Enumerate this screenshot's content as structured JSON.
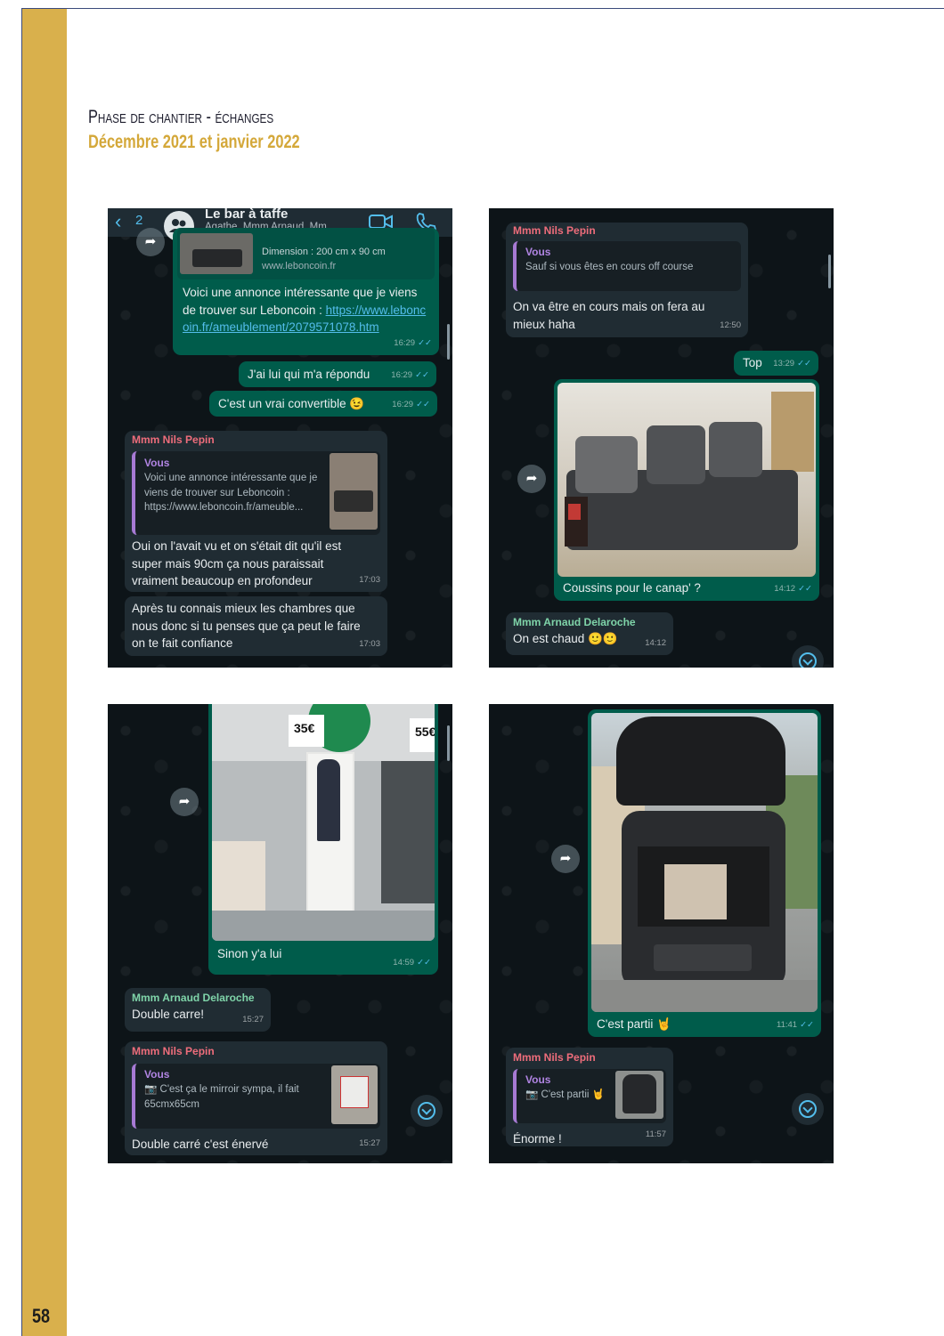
{
  "header": {
    "title": "Phase de chantier - échanges",
    "subtitle": "Décembre 2021 et janvier 2022"
  },
  "page_number": "58",
  "shot1": {
    "back_count": "2",
    "chat_title": "Le bar à taffe",
    "chat_members": "Agathe, Mmm Arnaud, Mm...",
    "preview_dimension": "Dimension : 200 cm x 90 cm",
    "preview_site": "www.leboncoin.fr",
    "msg1_text": "Voici une annonce intéressante que je viens de trouver sur Leboncoin : ",
    "msg1_link": "https://www.leboncoin.fr/ameublement/2079571078.htm",
    "msg1_time": "16:29",
    "msg2_text": "J'ai lui qui m'a répondu",
    "msg2_time": "16:29",
    "msg3_text": "C'est un vrai convertible 😉",
    "msg3_time": "16:29",
    "msg4_sender": "Mmm Nils Pepin",
    "msg4_quote_name": "Vous",
    "msg4_quote_text": "Voici une annonce intéressante que je viens de trouver sur Leboncoin : https://www.leboncoin.fr/ameuble...",
    "msg4_text": "Oui on l'avait vu et on s'était dit qu'il est super mais 90cm ça nous paraissait vraiment beaucoup en profondeur",
    "msg4_time": "17:03",
    "msg5_text": "Après tu connais mieux les chambres que nous donc si tu penses que ça peut le faire on te fait confiance",
    "msg5_time": "17:03"
  },
  "shot2": {
    "msg1_sender": "Mmm Nils Pepin",
    "msg1_quote_name": "Vous",
    "msg1_quote_text": "Sauf si vous êtes en cours off course",
    "msg1_text": "On va être en cours mais on fera au mieux haha",
    "msg1_time": "12:50",
    "msg2_text": "Top",
    "msg2_time": "13:29",
    "msg3_caption": "Coussins pour le canap' ?",
    "msg3_time": "14:12",
    "msg4_sender": "Mmm Arnaud Delaroche",
    "msg4_text": "On est chaud 🙂🙂",
    "msg4_time": "14:12"
  },
  "shot3": {
    "price1": "35€",
    "price2": "55€",
    "msg1_caption": "Sinon y'a lui",
    "msg1_time": "14:59",
    "msg2_sender": "Mmm Arnaud Delaroche",
    "msg2_text": "Double carre!",
    "msg2_time": "15:27",
    "msg3_sender": "Mmm Nils Pepin",
    "msg3_quote_name": "Vous",
    "msg3_quote_text": "📷 C'est ça le mirroir sympa, il fait 65cmx65cm",
    "msg3_text": "Double carré c'est énervé",
    "msg3_time": "15:27"
  },
  "shot4": {
    "msg1_caption": "C'est partii 🤘",
    "msg1_time": "11:41",
    "msg2_sender": "Mmm Nils Pepin",
    "msg2_quote_name": "Vous",
    "msg2_quote_text": "📷 C'est partii 🤘",
    "msg2_text": "Énorme !",
    "msg2_time": "11:57"
  }
}
